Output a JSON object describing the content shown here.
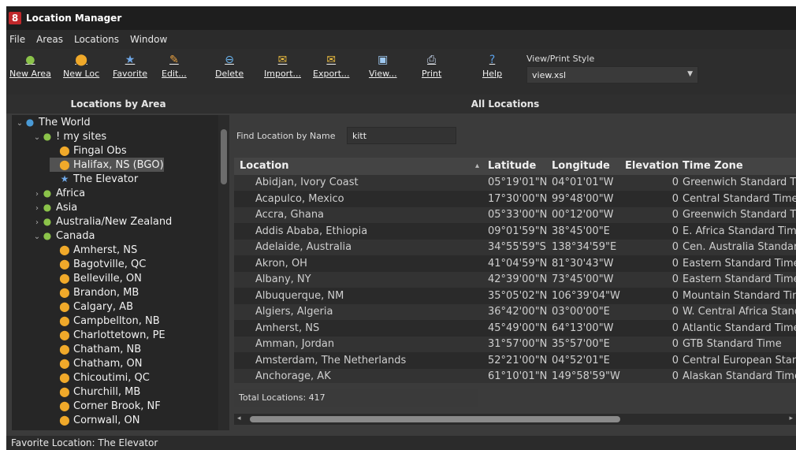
{
  "window": {
    "title": "Location Manager",
    "app_icon": "8"
  },
  "menu": [
    "File",
    "Areas",
    "Locations",
    "Window"
  ],
  "toolbar": {
    "buttons": [
      {
        "label": "New Area",
        "icon": "new-area-icon"
      },
      {
        "label": "New Loc",
        "icon": "new-location-pin-icon"
      },
      {
        "label": "Favorite",
        "icon": "favorite-star-icon"
      },
      {
        "label": "Edit...",
        "icon": "edit-pencil-icon"
      },
      {
        "label": "Delete",
        "icon": "delete-icon"
      },
      {
        "label": "Import...",
        "icon": "import-icon"
      },
      {
        "label": "Export...",
        "icon": "export-icon"
      },
      {
        "label": "View...",
        "icon": "view-icon"
      },
      {
        "label": "Print",
        "icon": "print-icon"
      },
      {
        "label": "Help",
        "icon": "help-icon"
      }
    ],
    "view_style_label": "View/Print Style",
    "view_style_value": "view.xsl"
  },
  "left_panel": {
    "header": "Locations by Area",
    "tree": [
      {
        "label": "The World",
        "depth": 0,
        "exp": "⌄",
        "icon": "globe-icon"
      },
      {
        "label": "! my sites",
        "depth": 1,
        "exp": "⌄",
        "icon": "folder-icon"
      },
      {
        "label": "Fingal Obs",
        "depth": 2,
        "exp": "",
        "icon": "pin-icon"
      },
      {
        "label": "Halifax, NS (BGO)",
        "depth": 2,
        "exp": "",
        "icon": "pin-icon",
        "selected": true
      },
      {
        "label": "The Elevator",
        "depth": 2,
        "exp": "",
        "icon": "star-icon"
      },
      {
        "label": "Africa",
        "depth": 1,
        "exp": "›",
        "icon": "folder-icon"
      },
      {
        "label": "Asia",
        "depth": 1,
        "exp": "›",
        "icon": "folder-icon"
      },
      {
        "label": "Australia/New Zealand",
        "depth": 1,
        "exp": "›",
        "icon": "folder-icon"
      },
      {
        "label": "Canada",
        "depth": 1,
        "exp": "⌄",
        "icon": "folder-icon"
      },
      {
        "label": "Amherst, NS",
        "depth": 2,
        "exp": "",
        "icon": "pin-icon"
      },
      {
        "label": "Bagotville, QC",
        "depth": 2,
        "exp": "",
        "icon": "pin-icon"
      },
      {
        "label": "Belleville, ON",
        "depth": 2,
        "exp": "",
        "icon": "pin-icon"
      },
      {
        "label": "Brandon, MB",
        "depth": 2,
        "exp": "",
        "icon": "pin-icon"
      },
      {
        "label": "Calgary, AB",
        "depth": 2,
        "exp": "",
        "icon": "pin-icon"
      },
      {
        "label": "Campbellton, NB",
        "depth": 2,
        "exp": "",
        "icon": "pin-icon"
      },
      {
        "label": "Charlottetown, PE",
        "depth": 2,
        "exp": "",
        "icon": "pin-icon"
      },
      {
        "label": "Chatham, NB",
        "depth": 2,
        "exp": "",
        "icon": "pin-icon"
      },
      {
        "label": "Chatham, ON",
        "depth": 2,
        "exp": "",
        "icon": "pin-icon"
      },
      {
        "label": "Chicoutimi, QC",
        "depth": 2,
        "exp": "",
        "icon": "pin-icon"
      },
      {
        "label": "Churchill, MB",
        "depth": 2,
        "exp": "",
        "icon": "pin-icon"
      },
      {
        "label": "Corner Brook, NF",
        "depth": 2,
        "exp": "",
        "icon": "pin-icon"
      },
      {
        "label": "Cornwall, ON",
        "depth": 2,
        "exp": "",
        "icon": "pin-icon"
      }
    ]
  },
  "right_panel": {
    "header": "All Locations",
    "find_label": "Find Location by Name",
    "find_value": "kitt",
    "columns": [
      "Location",
      "Latitude",
      "Longitude",
      "Elevation",
      "Time Zone"
    ],
    "sort_indicator": "▴",
    "rows": [
      [
        "Abidjan, Ivory Coast",
        "05°19'01\"N",
        "04°01'01\"W",
        "0",
        "Greenwich Standard Ti"
      ],
      [
        "Acapulco, Mexico",
        "17°30'00\"N",
        "99°48'00\"W",
        "0",
        "Central Standard Time"
      ],
      [
        "Accra, Ghana",
        "05°33'00\"N",
        "00°12'00\"W",
        "0",
        "Greenwich Standard Ti"
      ],
      [
        "Addis Ababa, Ethiopia",
        "09°01'59\"N",
        "38°45'00\"E",
        "0",
        "E. Africa Standard Time"
      ],
      [
        "Adelaide, Australia",
        "34°55'59\"S",
        "138°34'59\"E",
        "0",
        "Cen. Australia Standard"
      ],
      [
        "Akron, OH",
        "41°04'59\"N",
        "81°30'43\"W",
        "0",
        "Eastern Standard Time"
      ],
      [
        "Albany, NY",
        "42°39'00\"N",
        "73°45'00\"W",
        "0",
        "Eastern Standard Time"
      ],
      [
        "Albuquerque, NM",
        "35°05'02\"N",
        "106°39'04\"W",
        "0",
        "Mountain Standard Tim"
      ],
      [
        "Algiers, Algeria",
        "36°42'00\"N",
        "03°00'00\"E",
        "0",
        "W. Central Africa Stand"
      ],
      [
        "Amherst, NS",
        "45°49'00\"N",
        "64°13'00\"W",
        "0",
        "Atlantic Standard Time"
      ],
      [
        "Amman, Jordan",
        "31°57'00\"N",
        "35°57'00\"E",
        "0",
        "GTB Standard Time"
      ],
      [
        "Amsterdam, The Netherlands",
        "52°21'00\"N",
        "04°52'01\"E",
        "0",
        "Central European Stand"
      ],
      [
        "Anchorage, AK",
        "61°10'01\"N",
        "149°58'59\"W",
        "0",
        "Alaskan Standard Time"
      ]
    ],
    "total_text": "Total Locations: 417"
  },
  "status": {
    "text": "Favorite Location: The Elevator"
  }
}
